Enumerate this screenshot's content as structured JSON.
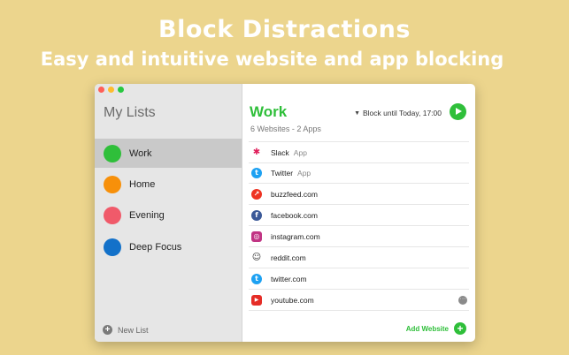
{
  "hero": {
    "title": "Block Distractions",
    "subtitle": "Easy and intuitive website and app blocking"
  },
  "window": {
    "traffic_lights": [
      "#ff5f57",
      "#febc2e",
      "#28c840"
    ]
  },
  "sidebar": {
    "title": "My Lists",
    "items": [
      {
        "label": "Work",
        "color": "#2fbf3a",
        "selected": true
      },
      {
        "label": "Home",
        "color": "#f7900a",
        "selected": false
      },
      {
        "label": "Evening",
        "color": "#f05a6a",
        "selected": false
      },
      {
        "label": "Deep Focus",
        "color": "#1371c9",
        "selected": false
      }
    ],
    "new_list_label": "New List"
  },
  "main": {
    "title": "Work",
    "subtitle": "6 Websites - 2 Apps",
    "block_until": "Block until Today, 17:00",
    "accent": "#2fbf3a",
    "sites": [
      {
        "name": "Slack",
        "kind": "App",
        "icon": "slack-icon",
        "color": "#e0e0e0",
        "glyph": "✱"
      },
      {
        "name": "Twitter",
        "kind": "App",
        "icon": "twitter-icon",
        "color": "#1da1f2",
        "glyph": "t"
      },
      {
        "name": "buzzfeed.com",
        "kind": "",
        "icon": "buzzfeed-icon",
        "color": "#ee3322",
        "glyph": "↗"
      },
      {
        "name": "facebook.com",
        "kind": "",
        "icon": "facebook-icon",
        "color": "#3b5998",
        "glyph": "f"
      },
      {
        "name": "instagram.com",
        "kind": "",
        "icon": "instagram-icon",
        "color": "#c13584",
        "glyph": "◎"
      },
      {
        "name": "reddit.com",
        "kind": "",
        "icon": "reddit-icon",
        "color": "#ffffff",
        "glyph": "☺"
      },
      {
        "name": "twitter.com",
        "kind": "",
        "icon": "twitter-icon",
        "color": "#1da1f2",
        "glyph": "t"
      },
      {
        "name": "youtube.com",
        "kind": "",
        "icon": "youtube-icon",
        "color": "#e52d27",
        "glyph": "▶"
      }
    ],
    "add_website_label": "Add Website"
  }
}
